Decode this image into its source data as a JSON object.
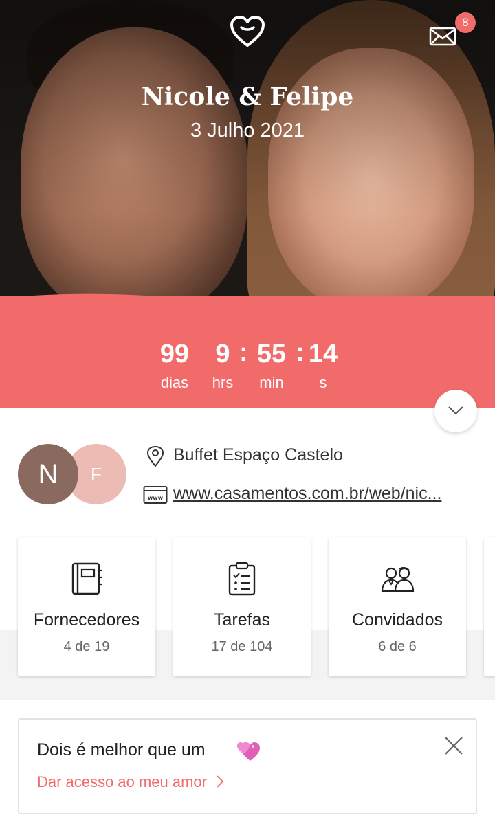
{
  "header": {
    "couple_names": "Nicole & Felipe",
    "wedding_date": "3 Julho 2021",
    "unread_messages": "8"
  },
  "countdown": {
    "days": "99",
    "days_label": "dias",
    "hours": "9",
    "hours_label": "hrs",
    "minutes": "55",
    "minutes_label": "min",
    "seconds": "14",
    "seconds_label": "s",
    "separator": ":"
  },
  "profile": {
    "avatar_a_initial": "N",
    "avatar_b_initial": "F",
    "venue": "Buffet Espaço Castelo",
    "website": "www.casamentos.com.br/web/nic..."
  },
  "cards": [
    {
      "title": "Fornecedores",
      "progress": "4 de 19",
      "icon": "notebook-icon"
    },
    {
      "title": "Tarefas",
      "progress": "17 de 104",
      "icon": "checklist-icon"
    },
    {
      "title": "Convidados",
      "progress": "6 de 6",
      "icon": "guests-icon"
    }
  ],
  "promo": {
    "title": "Dois é melhor que um",
    "link": "Dar acesso ao meu amor"
  },
  "colors": {
    "accent": "#f26b6b",
    "avatar_a": "#8a6a5e",
    "avatar_b": "#ecbbb3"
  }
}
